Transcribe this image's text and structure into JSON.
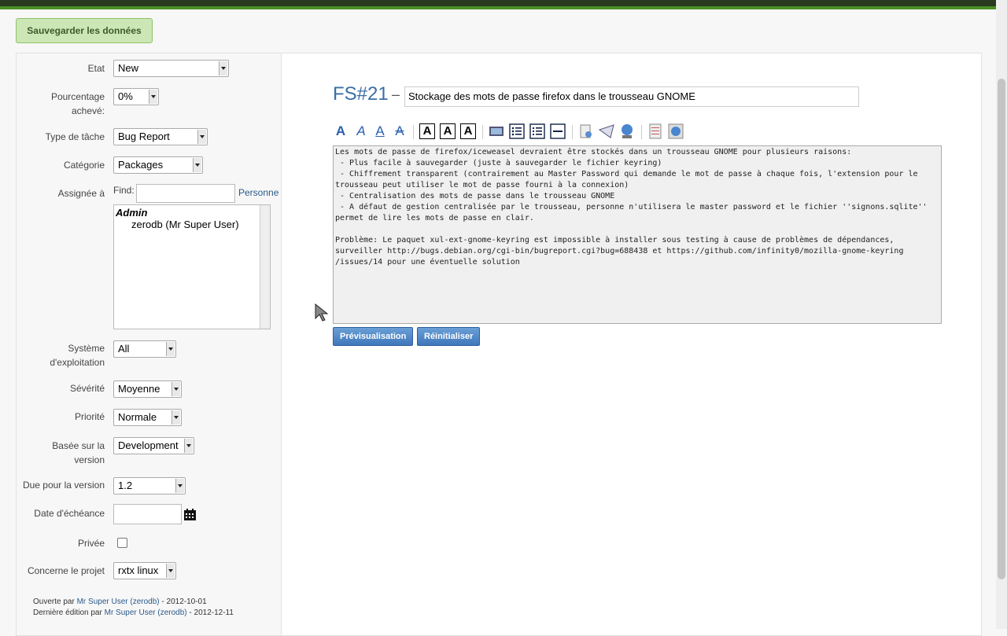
{
  "save_button": "Sauvegarder les données",
  "fields": {
    "etat": {
      "label": "Etat",
      "value": "New"
    },
    "pourcentage": {
      "label1": "Pourcentage",
      "label2": "achevé:",
      "value": "0%"
    },
    "type": {
      "label": "Type de tâche",
      "value": "Bug Report"
    },
    "categorie": {
      "label": "Catégorie",
      "value": "Packages"
    },
    "assignee": {
      "label": "Assignée à",
      "find_label": "Find:",
      "find_value": "",
      "personne": "Personne",
      "group": "Admin",
      "user": "zerodb (Mr Super User)"
    },
    "systeme": {
      "label1": "Système",
      "label2": "d'exploitation",
      "value": "All"
    },
    "severite": {
      "label": "Sévérité",
      "value": "Moyenne"
    },
    "priorite": {
      "label": "Priorité",
      "value": "Normale"
    },
    "basee": {
      "label1": "Basée sur la",
      "label2": "version",
      "value": "Development"
    },
    "due": {
      "label": "Due pour la version",
      "value": "1.2"
    },
    "echeance": {
      "label": "Date d'échéance",
      "value": ""
    },
    "privee": {
      "label": "Privée"
    },
    "projet": {
      "label": "Concerne le projet",
      "value": "rxtx linux"
    }
  },
  "meta": {
    "opened_prefix": "Ouverte par ",
    "opened_user": "Mr Super User (zerodb)",
    "opened_date": " - 2012-10-01",
    "edited_prefix": "Dernière édition par ",
    "edited_user": "Mr Super User (zerodb)",
    "edited_date": " - 2012-12-11"
  },
  "task": {
    "id": "FS#21",
    "dash": "–",
    "summary": "Stockage des mots de passe firefox dans le trousseau GNOME",
    "description": "Les mots de passe de firefox/iceweasel devraient être stockés dans un trousseau GNOME pour plusieurs raisons:\n - Plus facile à sauvegarder (juste à sauvegarder le fichier keyring)\n - Chiffrement transparent (contrairement au Master Password qui demande le mot de passe à chaque fois, l'extension pour le\ntrousseau peut utiliser le mot de passe fourni à la connexion)\n - Centralisation des mots de passe dans le trousseau GNOME\n - A défaut de gestion centralisée par le trousseau, personne n'utilisera le master password et le fichier ''signons.sqlite''\npermet de lire les mots de passe en clair.\n\nProblème: Le paquet xul-ext-gnome-keyring est impossible à installer sous testing à cause de problèmes de dépendances,\nsurveiller http://bugs.debian.org/cgi-bin/bugreport.cgi?bug=688438 et https://github.com/infinity0/mozilla-gnome-keyring\n/issues/14 pour une éventuelle solution"
  },
  "buttons": {
    "preview": "Prévisualisation",
    "reset": "Réinitialiser"
  },
  "toolbar_icons": [
    "bold-a-icon",
    "italic-a-icon",
    "underline-a-icon",
    "strike-a-icon",
    "h1-icon",
    "h2-icon",
    "h3-icon",
    "image-icon",
    "bullet-list-icon",
    "numbered-list-icon",
    "horizontal-rule-icon",
    "link-icon",
    "email-icon",
    "web-link-icon",
    "code-icon",
    "preview-icon"
  ],
  "colors": {
    "accent": "#3a6ea5",
    "save_bg": "#cde6b6",
    "topbar": "#4a8f24"
  }
}
